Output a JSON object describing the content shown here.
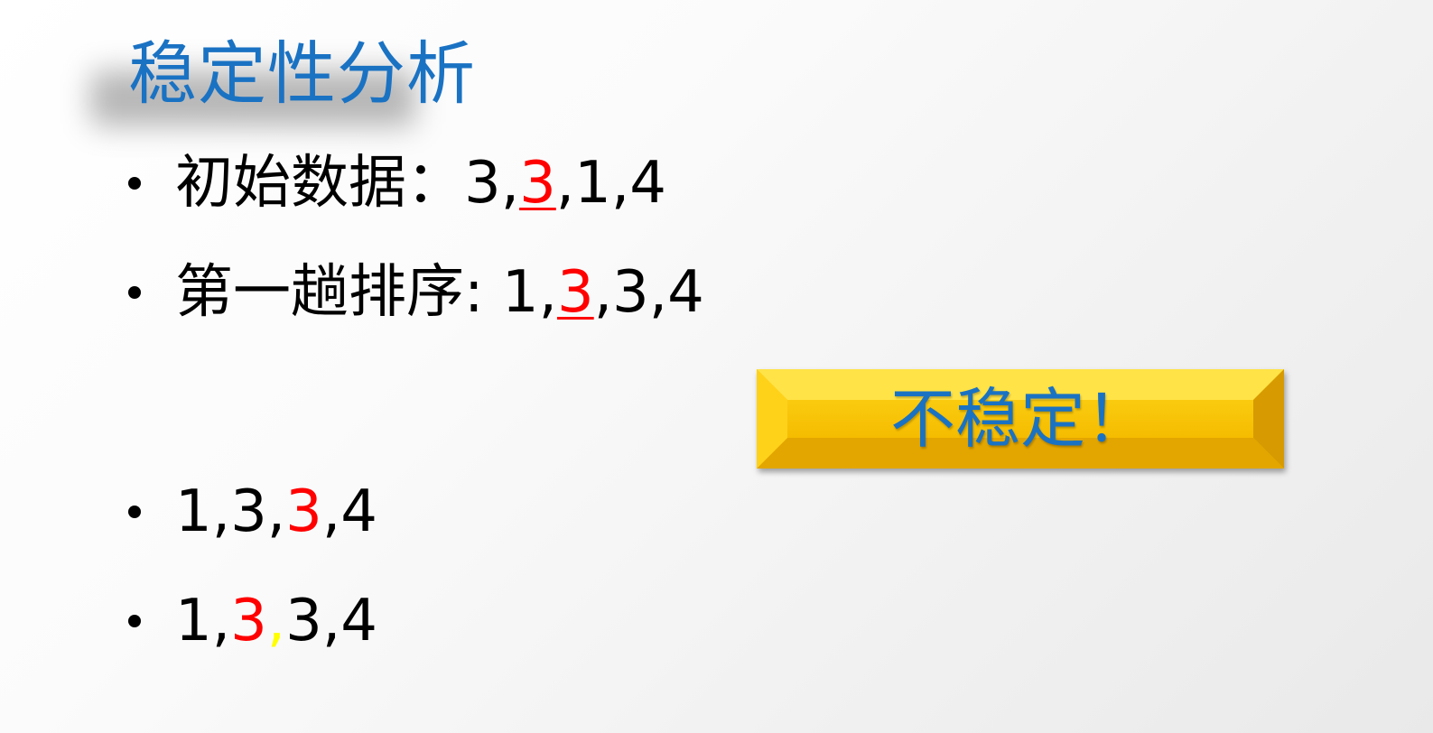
{
  "slide": {
    "title": "稳定性分析",
    "bullets": [
      {
        "label": "初始数据：",
        "value_segments": [
          {
            "text": "3,",
            "style": "normal"
          },
          {
            "text": "3",
            "style": "red-underline"
          },
          {
            "text": ",1,4",
            "style": "normal"
          }
        ]
      },
      {
        "label": "第一趟排序: ",
        "value_segments": [
          {
            "text": "1,",
            "style": "normal"
          },
          {
            "text": "3",
            "style": "red-underline"
          },
          {
            "text": ",3,4",
            "style": "normal"
          }
        ]
      },
      {
        "label": "",
        "value_segments": [
          {
            "text": "1,3,",
            "style": "normal"
          },
          {
            "text": "3",
            "style": "red"
          },
          {
            "text": ",4",
            "style": "normal"
          }
        ]
      },
      {
        "label": "",
        "value_segments": [
          {
            "text": "1,",
            "style": "normal"
          },
          {
            "text": "3",
            "style": "red"
          },
          {
            "text": ",",
            "style": "yellow"
          },
          {
            "text": "3,4",
            "style": "normal"
          }
        ]
      }
    ],
    "badge": {
      "text": "不稳定！"
    }
  },
  "colors": {
    "title": "#1A72C3",
    "highlight_red": "#FF0000",
    "highlight_yellow": "#FFFF00",
    "badge_fill": "#F8C200",
    "badge_text": "#1A72C3"
  }
}
